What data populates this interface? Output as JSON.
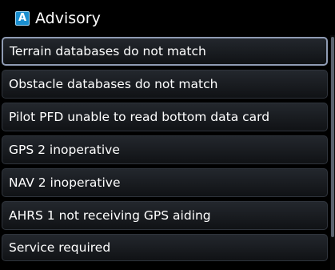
{
  "header": {
    "badge": "A",
    "title": "Advisory"
  },
  "messages": [
    {
      "text": "Terrain databases do not match",
      "selected": true
    },
    {
      "text": "Obstacle databases do not match",
      "selected": false
    },
    {
      "text": "Pilot PFD unable to read bottom data card",
      "selected": false
    },
    {
      "text": "GPS 2 inoperative",
      "selected": false
    },
    {
      "text": "NAV 2 inoperative",
      "selected": false
    },
    {
      "text": "AHRS 1 not receiving GPS aiding",
      "selected": false
    },
    {
      "text": "Service required",
      "selected": false
    }
  ],
  "colors": {
    "background": "#000000",
    "badge": "#1a8fd0",
    "text": "#ffffff",
    "selection_border": "#8f9bb3"
  }
}
